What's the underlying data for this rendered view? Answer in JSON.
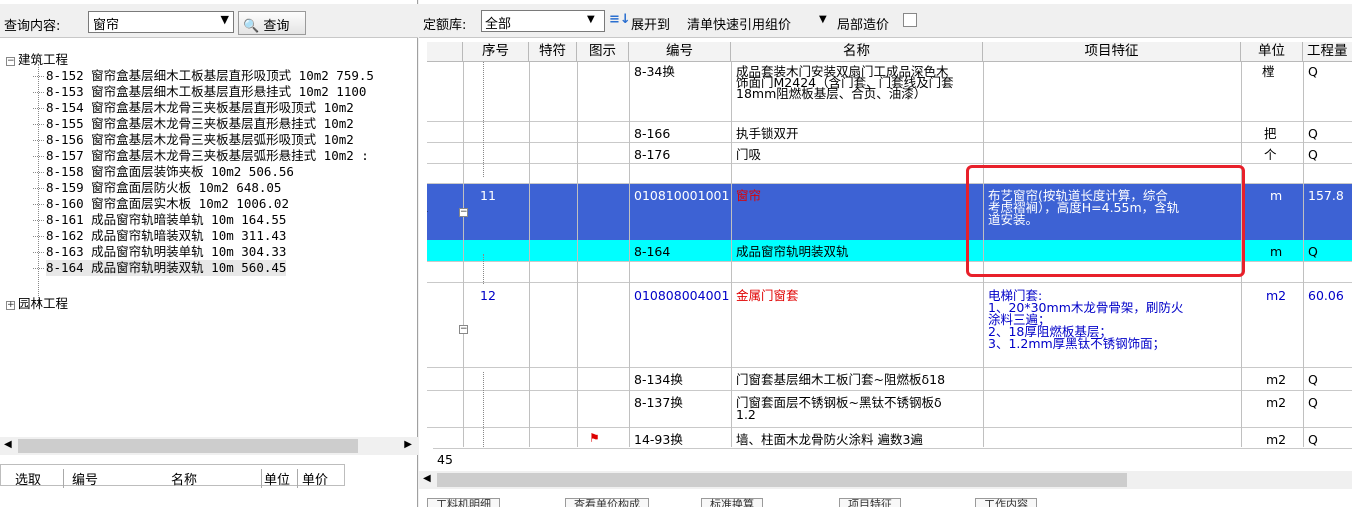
{
  "left_panel": {
    "query_label": "查询内容:",
    "query_value": "窗帘",
    "query_button": "查询",
    "tree": {
      "root1": "建筑工程",
      "items": [
        "8-152 窗帘盒基层细木工板基层直形吸顶式 10m2 759.5",
        "8-153 窗帘盒基层细木工板基层直形悬挂式 10m2 1100",
        "8-154 窗帘盒基层木龙骨三夹板基层直形吸顶式 10m2",
        "8-155 窗帘盒基层木龙骨三夹板基层直形悬挂式 10m2",
        "8-156 窗帘盒基层木龙骨三夹板基层弧形吸顶式 10m2",
        "8-157 窗帘盒基层木龙骨三夹板基层弧形悬挂式 10m2 :",
        "8-158 窗帘盒面层装饰夹板 10m2 506.56",
        "8-159 窗帘盒面层防火板 10m2 648.05",
        "8-160 窗帘盒面层实木板 10m2 1006.02",
        "8-161 成品窗帘轨暗装单轨 10m 164.55",
        "8-162 成品窗帘轨暗装双轨 10m 311.43",
        "8-163 成品窗帘轨明装单轨 10m 304.33",
        "8-164 成品窗帘轨明装双轨 10m 560.45"
      ],
      "root2": "园林工程"
    },
    "footer": {
      "select": "选取",
      "code": "编号",
      "name": "名称",
      "unit": "单位",
      "price": "单价"
    }
  },
  "toolbar": {
    "quota_label": "定额库:",
    "quota_value": "全部",
    "expand_label": "展开到",
    "quick_ref_label": "清单快速引用组价",
    "local_price_label": "局部造价"
  },
  "table": {
    "headers": [
      "序号",
      "特符",
      "图示",
      "编号",
      "名称",
      "项目特征",
      "单位",
      "工程量"
    ],
    "rows": [
      {
        "seq": "",
        "code": "8-34换",
        "name": "成品套装木门安装双扇门工成品深色木饰面门M2424（含门套、门套线及门套18mm阻燃板基层、合页、油漆）",
        "name_lines": [
          "成品套装木门安装双扇门工成品深色木",
          "饰面门M2424（含门套、门套线及门套",
          "18mm阻燃板基层、合页、油漆）"
        ],
        "feature": "",
        "unit": "樘",
        "qty": "Q"
      },
      {
        "seq": "",
        "code": "8-166",
        "name": "执手锁双开",
        "feature": "",
        "unit": "把",
        "qty": "Q"
      },
      {
        "seq": "",
        "code": "8-176",
        "name": "门吸",
        "feature": "",
        "unit": "个",
        "qty": "Q"
      },
      {
        "seq": "11",
        "code": "010810001001",
        "name": "窗帘",
        "feature_lines": [
          "布艺窗帘(按轨道长度计算，综合",
          "考虑褶裥），高度H=4.55m，含轨",
          "道安装。"
        ],
        "unit": "m",
        "qty": "157.8"
      },
      {
        "seq": "",
        "code": "8-164",
        "name": "成品窗帘轨明装双轨",
        "feature": "",
        "unit": "m",
        "qty": "Q"
      },
      {
        "seq": "12",
        "code": "010808004001",
        "name": "金属门窗套",
        "feature_lines": [
          "电梯门套:",
          "1、20*30mm木龙骨骨架，刷防火",
          "涂料三遍；",
          "2、18厚阻燃板基层；",
          "3、1.2mm厚黑钛不锈钢饰面；"
        ],
        "unit": "m2",
        "qty": "60.06"
      },
      {
        "seq": "",
        "code": "8-134换",
        "name": "门窗套基层细木工板门套~阻燃板δ18",
        "feature": "",
        "unit": "m2",
        "qty": "Q"
      },
      {
        "seq": "",
        "code": "8-137换",
        "name_lines": [
          "门窗套面层不锈钢板~黑钛不锈钢板δ",
          "1.2"
        ],
        "feature": "",
        "unit": "m2",
        "qty": "Q"
      },
      {
        "seq": "",
        "code": "14-93换",
        "name": "墙、柱面木龙骨防火涂料 遍数3遍",
        "feature": "",
        "unit": "m2",
        "qty": "Q"
      }
    ],
    "row_count": "45"
  },
  "bottom_tabs": [
    "工料机明细",
    "查看单价构成",
    "标准换算",
    "项目特征",
    "工作内容"
  ]
}
